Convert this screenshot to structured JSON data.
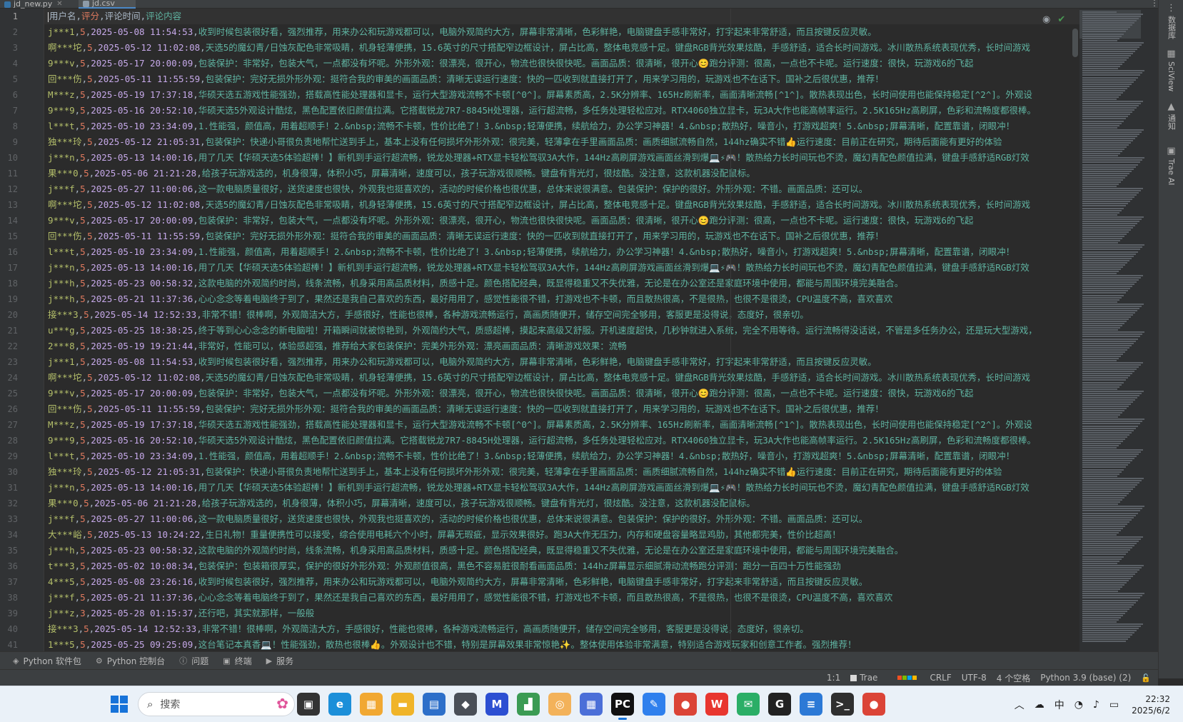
{
  "tabs": [
    {
      "label": "jd_new.py",
      "active": false,
      "icon": "python-file-icon",
      "color": "#3572a5"
    },
    {
      "label": "jd.csv",
      "active": true,
      "icon": "csv-file-icon",
      "color": "#8e9ba8"
    }
  ],
  "header": {
    "user": "用户名",
    "score": "评分",
    "time": "评论时间",
    "content": "评论内容"
  },
  "rows": [
    {
      "user": "j***1",
      "score": "5",
      "time": "2025-05-08 11:54:53",
      "content": "收到时候包装很好看，强烈推荐，用来办公和玩游戏都可以，电脑外观简约大方，屏幕非常清晰，色彩鲜艳，电脑键盘手感非常好，打字起来非常舒适，而且按键反应灵敏。"
    },
    {
      "user": "啊***坨",
      "score": "5",
      "time": "2025-05-12 11:02:08",
      "content": "天选5的魔幻青/日蚀灰配色非常吸睛，机身轻薄便携，15.6英寸的尺寸搭配窄边框设计，屏占比高，整体电竞感十足。键盘RGB背光效果炫酷，手感舒适，适合长时间游戏。冰川散热系统表现优秀，长时间游戏"
    },
    {
      "user": "9***v",
      "score": "5",
      "time": "2025-05-17 20:00:09",
      "content": "包装保护：非常好，包装大气，一点都没有坏呢。外形外观：很漂亮，很开心，物流也很快很快呢。画面品质：很清晰，很开心😊跑分评测：很高，一点也不卡呢。运行速度：很快，玩游戏6的飞起"
    },
    {
      "user": "回***伤",
      "score": "5",
      "time": "2025-05-11 11:55:59",
      "content": "包装保护：完好无损外形外观：挺符合我的审美的画面品质：清晰无误运行速度：快的一匹收到就直接打开了，用来学习用的，玩游戏也不在话下。国补之后很优惠，推荐！"
    },
    {
      "user": "M***z",
      "score": "5",
      "time": "2025-05-19 17:37:18",
      "content": "华硕天选五游戏性能强劲，搭载高性能处理器和显卡，运行大型游戏流畅不卡顿[^0^]。屏幕素质高，2.5K分辨率、165Hz刷新率，画面清晰流畅[^1^]。散热表现出色，长时间使用也能保持稳定[^2^]。外观设"
    },
    {
      "user": "9***9",
      "score": "5",
      "time": "2025-05-16 20:52:10",
      "content": "华硕天选5外观设计酷炫，黑色配置依旧颜值拉满。它搭载锐龙7R7-8845H处理器，运行超流畅，多任务处理轻松应对。RTX4060独立显卡，玩3A大作也能高帧率运行。2.5K165Hz高刷屏，色彩和流畅度都很棒。"
    },
    {
      "user": "l***t",
      "score": "5",
      "time": "2025-05-10 23:34:09",
      "content": "1.性能强，颜值高，用着超顺手！2.&nbsp;流畅不卡顿，性价比绝了！3.&nbsp;轻薄便携，续航给力，办公学习神器！4.&nbsp;散热好，噪音小，打游戏超爽！5.&nbsp;屏幕清晰，配置靠谱，闭眼冲！"
    },
    {
      "user": "独***玲",
      "score": "5",
      "time": "2025-05-12 21:05:31",
      "content": "包装保护：快递小哥很负责地帮忙送到手上，基本上没有任何损坏外形外观：很完美，轻薄拿在手里画面品质：画质细腻流畅自然，144hz确实不错👍运行速度：目前正在研究，期待后面能有更好的体验"
    },
    {
      "user": "j***n",
      "score": "5",
      "time": "2025-05-13 14:00:16",
      "content": "用了几天【华硕天选5体验超棒！】新机到手运行超流畅，锐龙处理器+RTX显卡轻松驾驭3A大作，144Hz高刷屏游戏画面丝滑到爆💻⚡🎮！散热给力长时间玩也不烫，魔幻青配色颜值拉满，键盘手感舒适RGB灯效"
    },
    {
      "user": "果***0",
      "score": "5",
      "time": "2025-05-06 21:21:28",
      "content": "给孩子玩游戏选的，机身很薄，体积小巧，屏幕清晰，速度可以，孩子玩游戏很顺畅。键盘有背光灯，很炫酷。没注意，这款机器没配鼠标。"
    },
    {
      "user": "j***f",
      "score": "5",
      "time": "2025-05-27 11:00:06",
      "content": "这一款电脑质量很好，送货速度也很快，外观我也挺喜欢的，活动的时候价格也很优惠，总体来说很满意。包装保护：保护的很好。外形外观：不错。画面品质：还可以。"
    },
    {
      "user": "啊***坨",
      "score": "5",
      "time": "2025-05-12 11:02:08",
      "content": "天选5的魔幻青/日蚀灰配色非常吸睛，机身轻薄便携，15.6英寸的尺寸搭配窄边框设计，屏占比高，整体电竞感十足。键盘RGB背光效果炫酷，手感舒适，适合长时间游戏。冰川散热系统表现优秀，长时间游戏"
    },
    {
      "user": "9***v",
      "score": "5",
      "time": "2025-05-17 20:00:09",
      "content": "包装保护：非常好，包装大气，一点都没有坏呢。外形外观：很漂亮，很开心，物流也很快很快呢。画面品质：很清晰，很开心😊跑分评测：很高，一点也不卡呢。运行速度：很快，玩游戏6的飞起"
    },
    {
      "user": "回***伤",
      "score": "5",
      "time": "2025-05-11 11:55:59",
      "content": "包装保护：完好无损外形外观：挺符合我的审美的画面品质：清晰无误运行速度：快的一匹收到就直接打开了，用来学习用的，玩游戏也不在话下。国补之后很优惠，推荐！"
    },
    {
      "user": "l***t",
      "score": "5",
      "time": "2025-05-10 23:34:09",
      "content": "1.性能强，颜值高，用着超顺手！2.&nbsp;流畅不卡顿，性价比绝了！3.&nbsp;轻薄便携，续航给力，办公学习神器！4.&nbsp;散热好，噪音小，打游戏超爽！5.&nbsp;屏幕清晰，配置靠谱，闭眼冲！"
    },
    {
      "user": "j***n",
      "score": "5",
      "time": "2025-05-13 14:00:16",
      "content": "用了几天【华硕天选5体验超棒！】新机到手运行超流畅，锐龙处理器+RTX显卡轻松驾驭3A大作，144Hz高刷屏游戏画面丝滑到爆💻⚡🎮！散热给力长时间玩也不烫，魔幻青配色颜值拉满，键盘手感舒适RGB灯效"
    },
    {
      "user": "j***h",
      "score": "5",
      "time": "2025-05-23 00:58:32",
      "content": "这款电脑的外观简约时尚，线条流畅，机身采用高品质材料，质感十足。颜色搭配经典，既显得稳重又不失优雅，无论是在办公室还是家庭环境中使用，都能与周围环境完美融合。"
    },
    {
      "user": "j***h",
      "score": "5",
      "time": "2025-05-21 11:37:36",
      "content": "心心念念等着电脑终于到了，果然还是我自己喜欢的东西，最好用用了，感觉性能很不错，打游戏也不卡顿，而且散热很高，不是很热，也很不是很烫，CPU温度不高，喜欢喜欢"
    },
    {
      "user": "接***3",
      "score": "5",
      "time": "2025-05-14 12:52:33",
      "content": "非常不错！很棒啊，外观简洁大方，手感很好，性能也很棒，各种游戏流畅运行，高画质随便开，储存空间完全够用，客服更是没得说，态度好，很亲切。"
    },
    {
      "user": "u***g",
      "score": "5",
      "time": "2025-05-25 18:38:25",
      "content": "终于等到心心念念的新电脑啦！开箱瞬间就被惊艳到，外观简约大气，质感超棒，摸起来高级又舒服。开机速度超快，几秒钟就进入系统，完全不用等待。运行流畅得没话说，不管是多任务办公，还是玩大型游戏，"
    },
    {
      "user": "2***8",
      "score": "5",
      "time": "2025-05-19 19:21:44",
      "content": "非常好，性能可以，体验感超强，推荐给大家包装保护：完美外形外观：漂亮画面品质：清晰游戏效果：流畅"
    },
    {
      "user": "j***1",
      "score": "5",
      "time": "2025-05-08 11:54:53",
      "content": "收到时候包装很好看，强烈推荐，用来办公和玩游戏都可以，电脑外观简约大方，屏幕非常清晰，色彩鲜艳，电脑键盘手感非常好，打字起来非常舒适，而且按键反应灵敏。"
    },
    {
      "user": "啊***坨",
      "score": "5",
      "time": "2025-05-12 11:02:08",
      "content": "天选5的魔幻青/日蚀灰配色非常吸睛，机身轻薄便携，15.6英寸的尺寸搭配窄边框设计，屏占比高，整体电竞感十足。键盘RGB背光效果炫酷，手感舒适，适合长时间游戏。冰川散热系统表现优秀，长时间游戏"
    },
    {
      "user": "9***v",
      "score": "5",
      "time": "2025-05-17 20:00:09",
      "content": "包装保护：非常好，包装大气，一点都没有坏呢。外形外观：很漂亮，很开心，物流也很快很快呢。画面品质：很清晰，很开心😊跑分评测：很高，一点也不卡呢。运行速度：很快，玩游戏6的飞起"
    },
    {
      "user": "回***伤",
      "score": "5",
      "time": "2025-05-11 11:55:59",
      "content": "包装保护：完好无损外形外观：挺符合我的审美的画面品质：清晰无误运行速度：快的一匹收到就直接打开了，用来学习用的，玩游戏也不在话下。国补之后很优惠，推荐！"
    },
    {
      "user": "M***z",
      "score": "5",
      "time": "2025-05-19 17:37:18",
      "content": "华硕天选五游戏性能强劲，搭载高性能处理器和显卡，运行大型游戏流畅不卡顿[^0^]。屏幕素质高，2.5K分辨率、165Hz刷新率，画面清晰流畅[^1^]。散热表现出色，长时间使用也能保持稳定[^2^]。外观设"
    },
    {
      "user": "9***9",
      "score": "5",
      "time": "2025-05-16 20:52:10",
      "content": "华硕天选5外观设计酷炫，黑色配置依旧颜值拉满。它搭载锐龙7R7-8845H处理器，运行超流畅，多任务处理轻松应对。RTX4060独立显卡，玩3A大作也能高帧率运行。2.5K165Hz高刷屏，色彩和流畅度都很棒。"
    },
    {
      "user": "l***t",
      "score": "5",
      "time": "2025-05-10 23:34:09",
      "content": "1.性能强，颜值高，用着超顺手！2.&nbsp;流畅不卡顿，性价比绝了！3.&nbsp;轻薄便携，续航给力，办公学习神器！4.&nbsp;散热好，噪音小，打游戏超爽！5.&nbsp;屏幕清晰，配置靠谱，闭眼冲！"
    },
    {
      "user": "独***玲",
      "score": "5",
      "time": "2025-05-12 21:05:31",
      "content": "包装保护：快递小哥很负责地帮忙送到手上，基本上没有任何损坏外形外观：很完美，轻薄拿在手里画面品质：画质细腻流畅自然，144hz确实不错👍运行速度：目前正在研究，期待后面能有更好的体验"
    },
    {
      "user": "j***n",
      "score": "5",
      "time": "2025-05-13 14:00:16",
      "content": "用了几天【华硕天选5体验超棒！】新机到手运行超流畅，锐龙处理器+RTX显卡轻松驾驭3A大作，144Hz高刷屏游戏画面丝滑到爆💻⚡🎮！散热给力长时间玩也不烫，魔幻青配色颜值拉满，键盘手感舒适RGB灯效"
    },
    {
      "user": "果***0",
      "score": "5",
      "time": "2025-05-06 21:21:28",
      "content": "给孩子玩游戏选的，机身很薄，体积小巧，屏幕清晰，速度可以，孩子玩游戏很顺畅。键盘有背光灯，很炫酷。没注意，这款机器没配鼠标。"
    },
    {
      "user": "j***f",
      "score": "5",
      "time": "2025-05-27 11:00:06",
      "content": "这一款电脑质量很好，送货速度也很快，外观我也挺喜欢的，活动的时候价格也很优惠，总体来说很满意。包装保护：保护的很好。外形外观：不错。画面品质：还可以。"
    },
    {
      "user": "大***峪",
      "score": "5",
      "time": "2025-05-13 10:24:22",
      "content": "生日礼物！重量便携性可以接受，综合使用电耗六个小时，屏幕无瑕疵，显示效果很好。跑3A大作无压力，内存和硬盘容量略显鸡肋，其他都完美，性价比超高！"
    },
    {
      "user": "j***h",
      "score": "5",
      "time": "2025-05-23 00:58:32",
      "content": "这款电脑的外观简约时尚，线条流畅，机身采用高品质材料，质感十足。颜色搭配经典，既显得稳重又不失优雅，无论是在办公室还是家庭环境中使用，都能与周围环境完美融合。"
    },
    {
      "user": "t***3",
      "score": "5",
      "time": "2025-05-02 10:08:34",
      "content": "包装保护：包装箱很厚实，保护的很好外形外观：外观颜值很高，黑色不容易脏很耐看画面品质：144hz屏幕显示细腻滑动流畅跑分评测：跑分一百四十万性能强劲"
    },
    {
      "user": "4***5",
      "score": "5",
      "time": "2025-05-08 23:26:16",
      "content": "收到时候包装很好，强烈推荐，用来办公和玩游戏都可以，电脑外观简约大方，屏幕非常清晰，色彩鲜艳，电脑键盘手感非常好，打字起来非常舒适，而且按键反应灵敏。"
    },
    {
      "user": "j***f",
      "score": "5",
      "time": "2025-05-21 11:37:36",
      "content": "心心念念等着电脑终于到了，果然还是我自己喜欢的东西，最好用用了，感觉性能很不错，打游戏也不卡顿，而且散热很高，不是很热，也很不是很烫，CPU温度不高，喜欢喜欢"
    },
    {
      "user": "j***z",
      "score": "3",
      "time": "2025-05-28 01:15:37",
      "content": "还行吧，其实就那样，一般般"
    },
    {
      "user": "接***3",
      "score": "5",
      "time": "2025-05-14 12:52:33",
      "content": "非常不错！很棒啊，外观简洁大方，手感很好，性能也很棒，各种游戏流畅运行，高画质随便开，储存空间完全够用，客服更是没得说，态度好，很亲切。"
    },
    {
      "user": "1***5",
      "score": "5",
      "time": "2025-05-25 09:25:09",
      "content": "这台笔记本真香💻！性能强劲，散热也很棒👍。外观设计也不错，特别是屏幕效果非常惊艳✨。整体使用体验非常满意，特别适合游戏玩家和创意工作者。强烈推荐！"
    }
  ],
  "gutter_numbers": [
    "1",
    "2",
    "3",
    "4",
    "5",
    "6",
    "7",
    "8",
    "9",
    "10",
    "11",
    "12",
    "13",
    "14",
    "15",
    "16",
    "17",
    "18",
    "19",
    "20",
    "21",
    "22",
    "23",
    "24",
    "25",
    "26",
    "27",
    "28",
    "29",
    "30",
    "31",
    "32",
    "33",
    "34",
    "35",
    "36",
    "37",
    "38",
    "39",
    "40",
    "41"
  ],
  "right_strip": [
    {
      "label": "数据库",
      "icon": "database-icon"
    },
    {
      "label": "SciView",
      "icon": "sciview-icon"
    },
    {
      "label": "通知",
      "icon": "bell-icon"
    },
    {
      "label": "Trae AI",
      "icon": "trae-ai-icon"
    }
  ],
  "tool_windows": [
    {
      "label": "Python 软件包",
      "icon": "packages-icon"
    },
    {
      "label": "Python 控制台",
      "icon": "python-console-icon"
    },
    {
      "label": "问题",
      "icon": "problems-icon"
    },
    {
      "label": "终端",
      "icon": "terminal-icon"
    },
    {
      "label": "服务",
      "icon": "services-icon"
    }
  ],
  "status": {
    "position": "1:1",
    "trae": "Trae",
    "line_sep": "CRLF",
    "encoding": "UTF-8",
    "indent": "4 个空格",
    "interpreter": "Python 3.9 (base) (2)"
  },
  "taskbar": {
    "search_placeholder": "搜索",
    "apps": [
      {
        "name": "task-view-icon",
        "color": "#333333",
        "glyph": "▣"
      },
      {
        "name": "edge-icon",
        "color": "#1c8fd9",
        "glyph": "e"
      },
      {
        "name": "widgets-icon",
        "color": "#f1a832",
        "glyph": "▦"
      },
      {
        "name": "file-explorer-icon",
        "color": "#f0b429",
        "glyph": "▬"
      },
      {
        "name": "store-icon",
        "color": "#2d6fc9",
        "glyph": "▤"
      },
      {
        "name": "app-cube-icon",
        "color": "#4a4f57",
        "glyph": "◆"
      },
      {
        "name": "app-m-icon",
        "color": "#2c4fd2",
        "glyph": "M"
      },
      {
        "name": "app-chart-icon",
        "color": "#3b9b53",
        "glyph": "▟"
      },
      {
        "name": "app-shell-icon",
        "color": "#f3b25a",
        "glyph": "◎"
      },
      {
        "name": "app-grid-icon",
        "color": "#4b6fd8",
        "glyph": "▦"
      },
      {
        "name": "pycharm-icon",
        "color": "#111111",
        "glyph": "PC"
      },
      {
        "name": "app-feather-icon",
        "color": "#2f80ed",
        "glyph": "✎"
      },
      {
        "name": "chrome-icon",
        "color": "#db4437",
        "glyph": "●"
      },
      {
        "name": "wps-icon",
        "color": "#e8362f",
        "glyph": "W"
      },
      {
        "name": "wechat-icon",
        "color": "#2bae66",
        "glyph": "✉"
      },
      {
        "name": "app-g-icon",
        "color": "#222222",
        "glyph": "G"
      },
      {
        "name": "notepad-icon",
        "color": "#2c79d6",
        "glyph": "≡"
      },
      {
        "name": "terminal-app-icon",
        "color": "#2f2f2f",
        "glyph": ">_"
      },
      {
        "name": "chrome-2-icon",
        "color": "#db4437",
        "glyph": "●"
      }
    ],
    "tray_ime": "中",
    "clock_time": "22:32",
    "clock_date": "2025/6/2"
  },
  "colors": {
    "accent": "#4a88c7",
    "user": "#b4bf6a",
    "score": "#e07a5f",
    "time": "#c5a8e8",
    "content": "#5fb3a1"
  }
}
